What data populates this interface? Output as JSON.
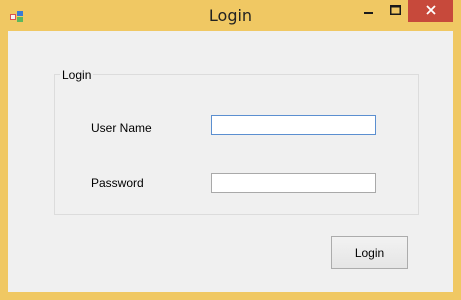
{
  "window": {
    "title": "Login",
    "frame_color": "#f0c863",
    "close_button_color": "#c7493b"
  },
  "icons": {
    "app": "app-icon",
    "minimize": "minimize-icon",
    "maximize": "maximize-icon",
    "close": "close-icon"
  },
  "form": {
    "group_title": "Login",
    "username_label": "User Name",
    "username_value": "",
    "password_label": "Password",
    "password_value": "",
    "submit_label": "Login"
  }
}
